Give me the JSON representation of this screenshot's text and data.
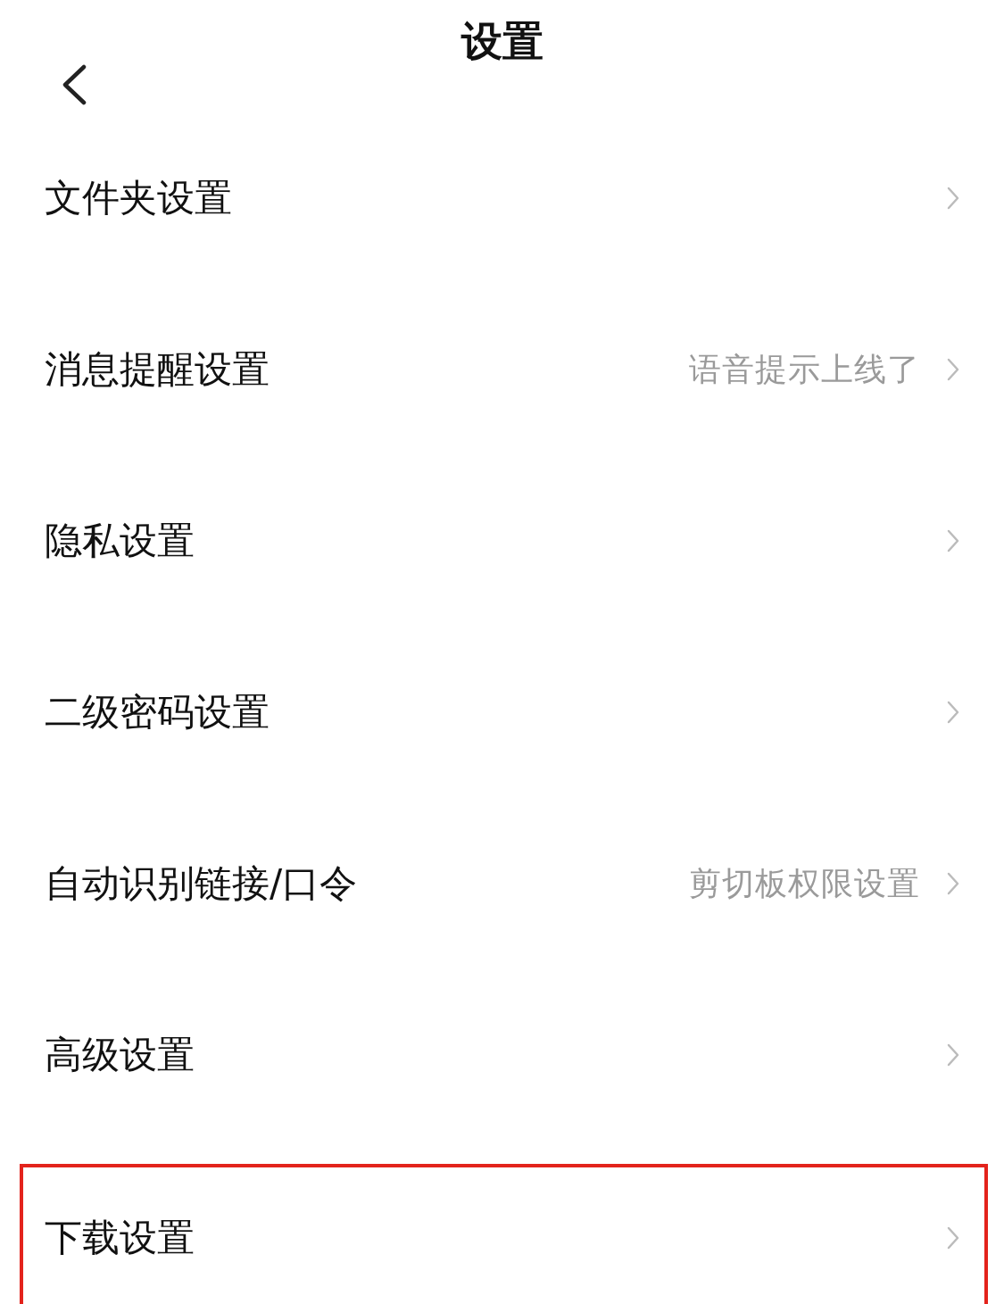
{
  "header": {
    "title": "设置"
  },
  "items": [
    {
      "label": "文件夹设置",
      "highlighted": false
    },
    {
      "label": "消息提醒设置",
      "hint": "语音提示上线了",
      "highlighted": false
    },
    {
      "label": "隐私设置",
      "highlighted": false
    },
    {
      "label": "二级密码设置",
      "highlighted": false
    },
    {
      "label": "自动识别链接/口令",
      "hint": "剪切板权限设置",
      "highlighted": false
    },
    {
      "label": "高级设置",
      "highlighted": false
    },
    {
      "label": "下载设置",
      "highlighted": true
    }
  ]
}
